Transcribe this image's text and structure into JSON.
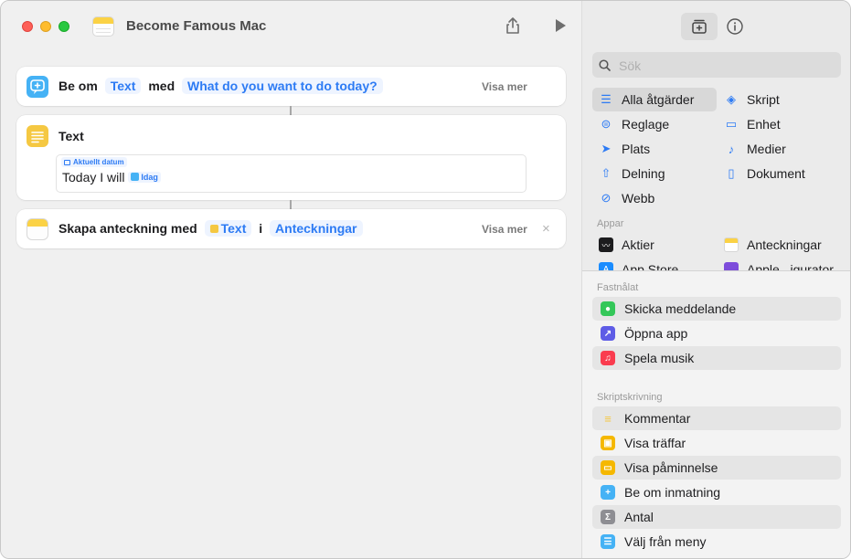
{
  "window": {
    "title": "Become Famous Mac"
  },
  "actions": [
    {
      "parts": [
        "Be om",
        "Text",
        "med",
        "What do you want to do today?"
      ],
      "visa": "Visa mer"
    },
    {
      "title": "Text",
      "token_label": "Aktuellt datum",
      "content": "Today I will",
      "inline_token": "Idag"
    },
    {
      "parts": [
        "Skapa anteckning med",
        "Text",
        "i",
        "Anteckningar"
      ],
      "visa": "Visa mer"
    }
  ],
  "sidebar": {
    "search_placeholder": "Sök",
    "categories": [
      {
        "label": "Alla åtgärder",
        "icon": "list-icon"
      },
      {
        "label": "Skript",
        "icon": "script-icon"
      },
      {
        "label": "Reglage",
        "icon": "toggle-icon"
      },
      {
        "label": "Enhet",
        "icon": "display-icon"
      },
      {
        "label": "Plats",
        "icon": "location-icon"
      },
      {
        "label": "Medier",
        "icon": "music-note-icon"
      },
      {
        "label": "Delning",
        "icon": "share-icon"
      },
      {
        "label": "Dokument",
        "icon": "document-icon"
      },
      {
        "label": "Webb",
        "icon": "compass-icon"
      }
    ],
    "apps_label": "Appar",
    "apps": [
      {
        "label": "Aktier",
        "icon": "stocks-icon"
      },
      {
        "label": "Anteckningar",
        "icon": "notes-icon"
      },
      {
        "label": "App Store",
        "icon": "app-store-icon"
      },
      {
        "label": "Apple...igurator",
        "icon": "configurator-icon"
      }
    ],
    "pinned_label": "Fastnålat",
    "pinned": [
      {
        "label": "Skicka meddelande",
        "color": "#34c759",
        "icon": "message-icon"
      },
      {
        "label": "Öppna app",
        "color": "#5e5ce6",
        "icon": "open-app-icon"
      },
      {
        "label": "Spela musik",
        "color": "#fa3c4f",
        "icon": "music-icon"
      }
    ],
    "scripting_label": "Skriptskrivning",
    "scripting": [
      {
        "label": "Kommentar",
        "color": "#f5c842",
        "icon": "comment-icon"
      },
      {
        "label": "Visa träffar",
        "color": "#f5b800",
        "icon": "results-icon"
      },
      {
        "label": "Visa påminnelse",
        "color": "#f5b800",
        "icon": "alert-icon"
      },
      {
        "label": "Be om inmatning",
        "color": "#45b2f5",
        "icon": "input-icon"
      },
      {
        "label": "Antal",
        "color": "#8e8e93",
        "icon": "sigma-icon"
      },
      {
        "label": "Välj från meny",
        "color": "#45b2f5",
        "icon": "menu-icon"
      }
    ]
  },
  "colors": {
    "accent": "#2d7bf4",
    "token_bg": "#eef4ff"
  }
}
